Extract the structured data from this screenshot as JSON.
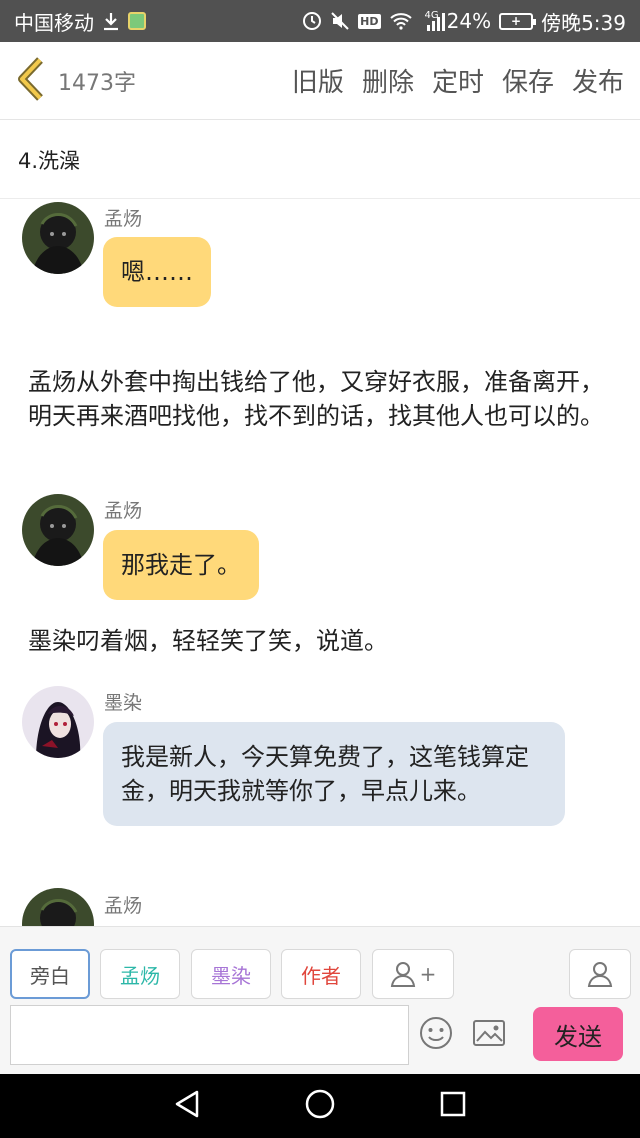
{
  "status_bar": {
    "carrier": "中国移动",
    "network": "4G",
    "battery": "24%",
    "time": "傍晚5:39",
    "icons": [
      "download-icon",
      "app-badge-icon",
      "alarm-icon",
      "mute-icon",
      "hd-icon",
      "wifi-icon",
      "signal-icon",
      "battery-icon"
    ]
  },
  "top_bar": {
    "word_count": "1473字",
    "actions": [
      "旧版",
      "删除",
      "定时",
      "保存",
      "发布"
    ]
  },
  "chapter_title": "4.洗澡",
  "messages": [
    {
      "type": "dialogue",
      "speaker": "孟炀",
      "text": "嗯……",
      "bubble_color": "#ffd97a"
    },
    {
      "type": "narration",
      "text": "孟炀从外套中掏出钱给了他，又穿好衣服，准备离开，明天再来酒吧找他，找不到的话，找其他人也可以的。"
    },
    {
      "type": "dialogue",
      "speaker": "孟炀",
      "text": "那我走了。",
      "bubble_color": "#ffd97a"
    },
    {
      "type": "narration",
      "text": "墨染叼着烟，轻轻笑了笑，说道。"
    },
    {
      "type": "dialogue",
      "speaker": "墨染",
      "text": "我是新人，今天算免费了，这笔钱算定金，明天我就等你了，早点儿来。",
      "bubble_color": "#dde5ef"
    },
    {
      "type": "dialogue",
      "speaker": "孟炀",
      "text": ""
    }
  ],
  "input_bar": {
    "roles": [
      {
        "label": "旁白",
        "color": "#555555"
      },
      {
        "label": "孟炀",
        "color": "#2cb7a8"
      },
      {
        "label": "墨染",
        "color": "#a775d6"
      },
      {
        "label": "作者",
        "color": "#e0463c"
      }
    ],
    "add_role_symbol": "+",
    "message_placeholder": "",
    "send_label": "发送",
    "accent_send": "#f45f9b"
  }
}
